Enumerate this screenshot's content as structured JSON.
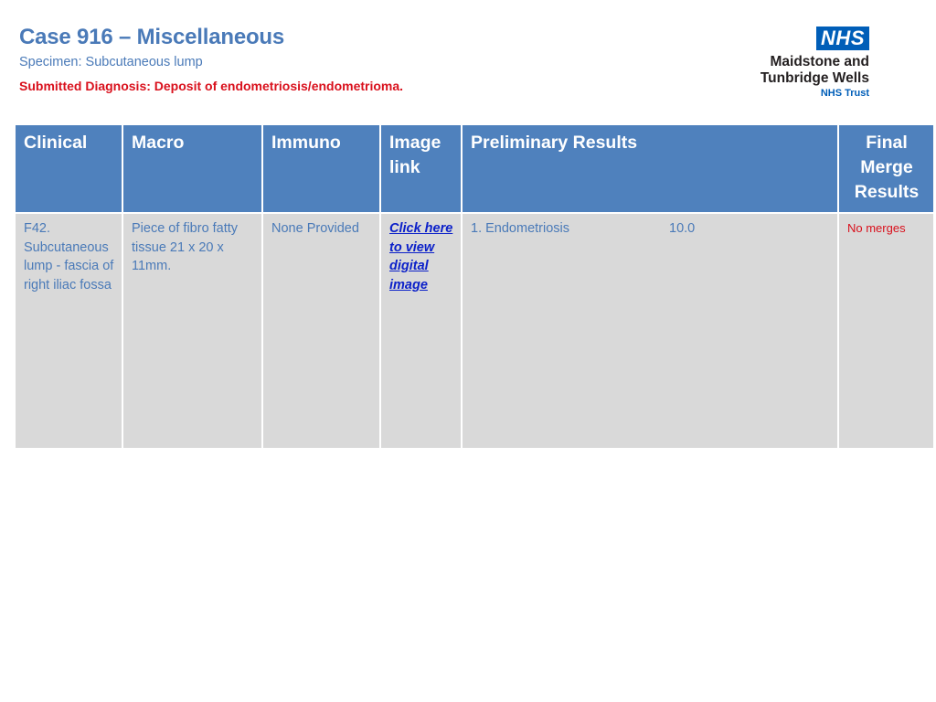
{
  "header": {
    "title": "Case 916 – Miscellaneous",
    "specimen": "Specimen: Subcutaneous lump",
    "diagnosis": "Submitted Diagnosis:  Deposit of endometriosis/endometrioma."
  },
  "logo": {
    "mark": "NHS",
    "org_line1": "Maidstone and",
    "org_line2": "Tunbridge Wells",
    "org_line3": "NHS Trust",
    "brand_color": "#005eb8"
  },
  "table": {
    "headers": {
      "clinical": "Clinical",
      "macro": "Macro",
      "immuno": "Immuno",
      "image_link": "Image link",
      "preliminary": "Preliminary Results",
      "final_merge": "Final Merge Results"
    },
    "row": {
      "clinical": "F42. Subcutaneous lump - fascia of right iliac fossa",
      "macro": "Piece of fibro fatty tissue 21 x 20 x 11mm.",
      "immuno": "None Provided",
      "image_link": "Click here to view digital image",
      "preliminary": {
        "result": "1. Endometriosis",
        "score": "10.0"
      },
      "final_merge": "No merges"
    }
  },
  "colors": {
    "title": "#4a7ab8",
    "diagnosis": "#d9101c",
    "header_bg": "#4f81bd",
    "cell_bg": "#d9d9d9",
    "link": "#0b20c9"
  }
}
